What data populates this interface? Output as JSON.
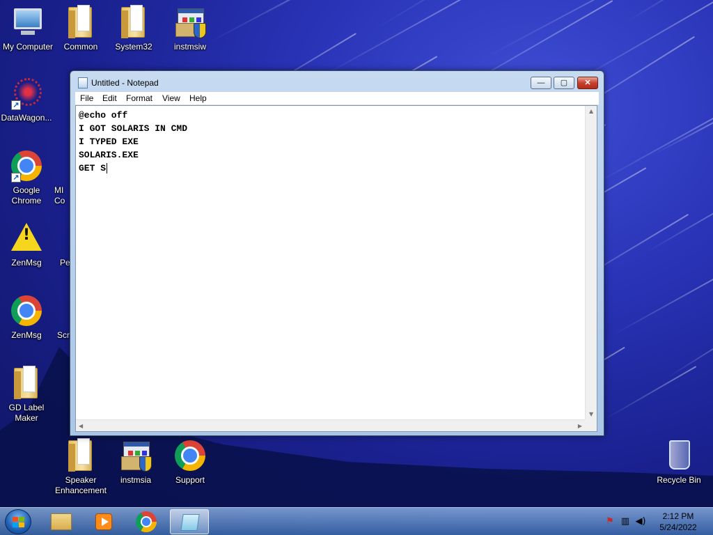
{
  "desktop": {
    "icons": [
      {
        "label": "My Computer",
        "icon": "computer-icon"
      },
      {
        "label": "Common",
        "icon": "folder-icon"
      },
      {
        "label": "System32",
        "icon": "folder-icon"
      },
      {
        "label": "instmsiw",
        "icon": "installer-icon"
      },
      {
        "label": "DataWagon...",
        "icon": "datawagon-icon"
      },
      {
        "label": "Google Chrome",
        "icon": "chrome-icon"
      },
      {
        "label": "ZenMsg",
        "icon": "warning-icon"
      },
      {
        "label": "ZenMsg",
        "icon": "chrome-icon"
      },
      {
        "label": "GD Label Maker",
        "icon": "folder-icon"
      },
      {
        "label": "Speaker Enhancement",
        "icon": "folder-icon"
      },
      {
        "label": "instmsia",
        "icon": "installer-icon"
      },
      {
        "label": "Support",
        "icon": "chrome-icon"
      },
      {
        "label": "Recycle Bin",
        "icon": "recycle-bin-icon"
      }
    ],
    "partial_labels": [
      "MI",
      "Co",
      "Pe",
      "Scr"
    ]
  },
  "notepad": {
    "title": "Untitled - Notepad",
    "menu": [
      "File",
      "Edit",
      "Format",
      "View",
      "Help"
    ],
    "lines": [
      "@echo off",
      "I GOT SOLARIS IN CMD",
      "I TYPED EXE",
      "SOLARIS.EXE",
      "GET S"
    ],
    "controls": {
      "minimize": "—",
      "maximize": "▢",
      "close": "✕"
    }
  },
  "taskbar": {
    "items": [
      "start-orb-icon",
      "explorer-icon",
      "media-player-icon",
      "chrome-icon",
      "notepad-icon"
    ],
    "clock": {
      "time": "2:12 PM",
      "date": "5/24/2022"
    },
    "tray": [
      "action-center-icon",
      "network-icon",
      "volume-icon"
    ]
  },
  "colors": {
    "accent": "#2a34b8",
    "close": "#c8412e"
  }
}
